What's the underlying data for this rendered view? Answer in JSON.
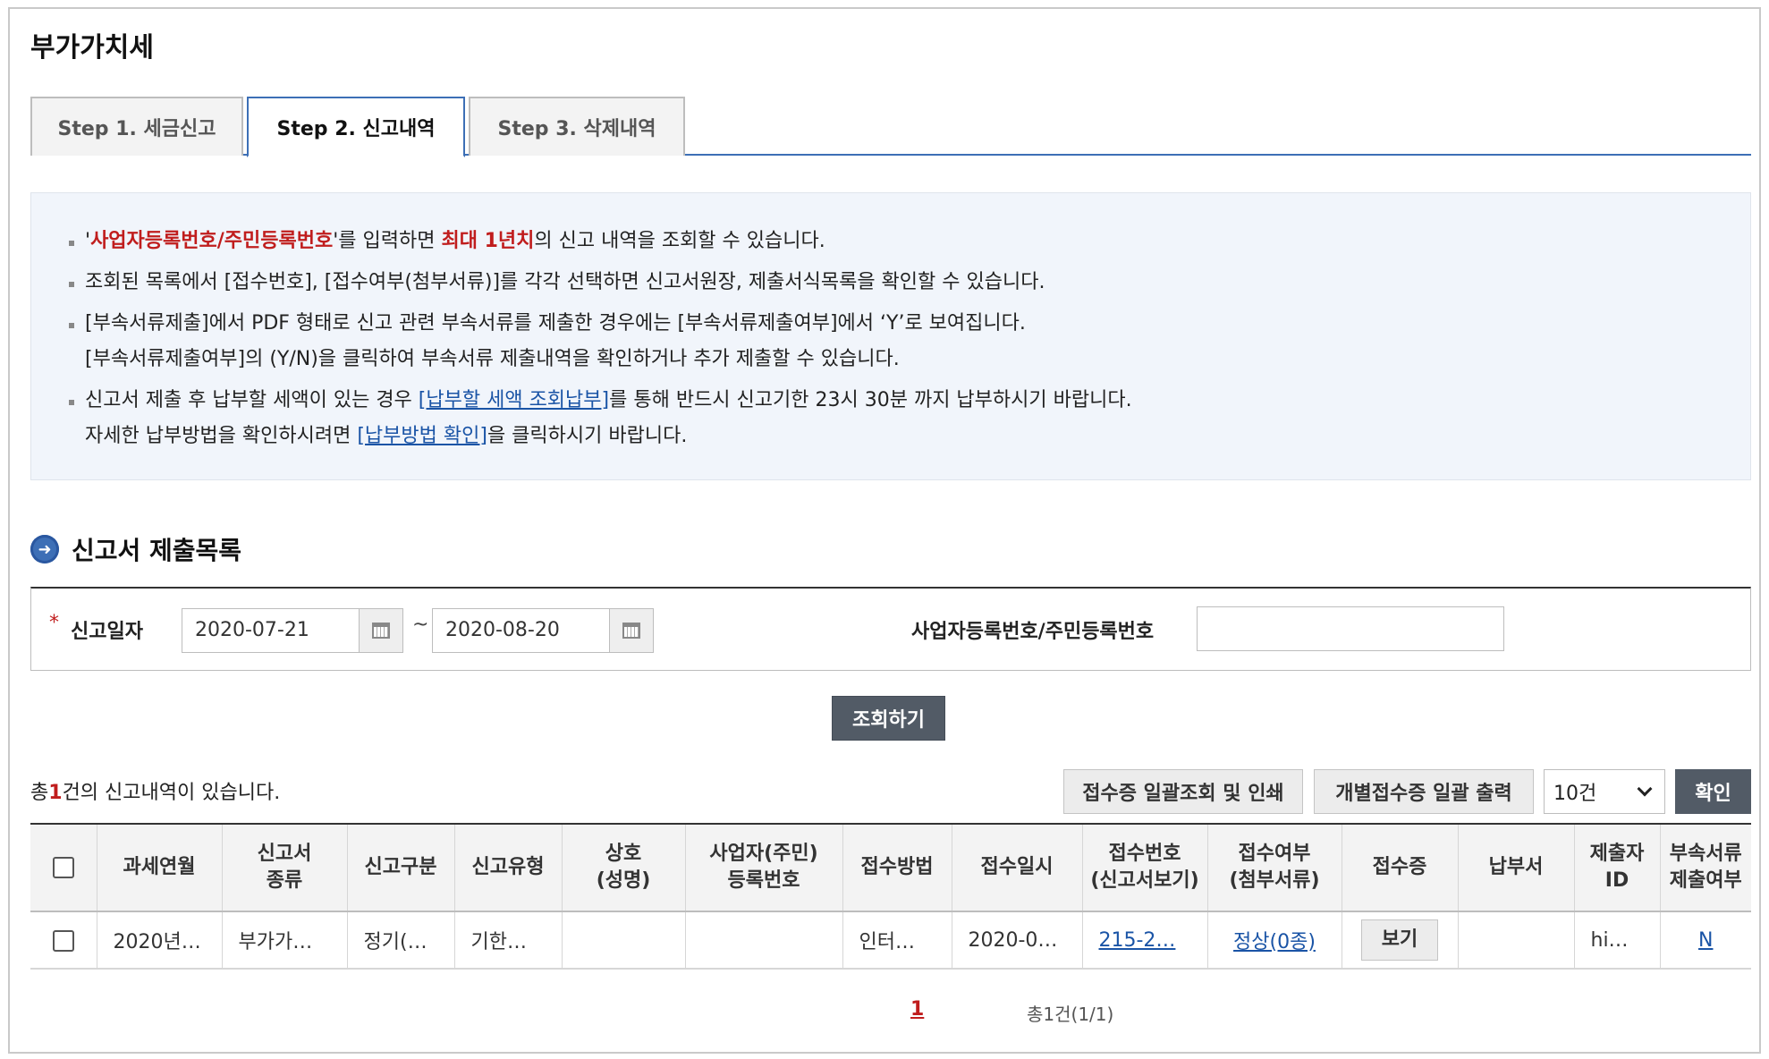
{
  "page_title": "부가가치세",
  "tabs": [
    {
      "label": "Step 1. 세금신고"
    },
    {
      "label": "Step 2. 신고내역"
    },
    {
      "label": "Step 3. 삭제내역"
    }
  ],
  "info": {
    "l1_q1": "'",
    "l1_red1": "사업자등록번호/주민등록번호",
    "l1_t1": "'를 입력하면 ",
    "l1_red2": "최대 1년치",
    "l1_t2": "의 신고 내역을 조회할 수 있습니다.",
    "l2": "조회된 목록에서 [접수번호], [접수여부(첨부서류)]를 각각 선택하면 신고서원장, 제출서식목록을 확인할 수 있습니다.",
    "l3a": "[부속서류제출]에서 PDF 형태로 신고 관련 부속서류를 제출한 경우에는 [부속서류제출여부]에서 ‘Y’로 보여집니다.",
    "l3b": "[부속서류제출여부]의 (Y/N)을 클릭하여 부속서류 제출내역을 확인하거나 추가 제출할 수 있습니다.",
    "l4_t1": "신고서 제출 후 납부할 세액이 있는 경우 ",
    "l4_link": "[납부할 세액 조회납부]",
    "l4_t2": "를 통해 반드시 신고기한 23시 30분 까지 납부하시기 바랍니다.",
    "l5_t1": "자세한 납부방법을 확인하시려면 ",
    "l5_link": "[납부방법 확인]",
    "l5_t2": "을 클릭하시기 바랍니다."
  },
  "section_title": "신고서 제출목록",
  "search": {
    "required_mark": "*",
    "date_label": "신고일자",
    "date_from": "2020-07-21",
    "tilde": "~",
    "date_to": "2020-08-20",
    "biz_label": "사업자등록번호/주민등록번호",
    "biz_value": ""
  },
  "search_button": "조회하기",
  "total": {
    "prefix": "총",
    "count": "1",
    "suffix": "건의 신고내역이 있습니다."
  },
  "actions": {
    "bulk_print": "접수증 일괄조회 및 인쇄",
    "individual_print": "개별접수증 일괄 출력",
    "page_size": "10건",
    "confirm": "확인"
  },
  "table": {
    "headers": [
      {
        "l1": "과세연월",
        "l2": ""
      },
      {
        "l1": "신고서",
        "l2": "종류"
      },
      {
        "l1": "신고구분",
        "l2": ""
      },
      {
        "l1": "신고유형",
        "l2": ""
      },
      {
        "l1": "상호",
        "l2": "(성명)"
      },
      {
        "l1": "사업자(주민)",
        "l2": "등록번호"
      },
      {
        "l1": "접수방법",
        "l2": ""
      },
      {
        "l1": "접수일시",
        "l2": ""
      },
      {
        "l1": "접수번호",
        "l2": "(신고서보기)"
      },
      {
        "l1": "접수여부",
        "l2": "(첨부서류)"
      },
      {
        "l1": "접수증",
        "l2": ""
      },
      {
        "l1": "납부서",
        "l2": ""
      },
      {
        "l1": "제출자",
        "l2": "ID"
      },
      {
        "l1": "부속서류",
        "l2": "제출여부"
      }
    ],
    "row": {
      "period": "2020년…",
      "doc_type": "부가가…",
      "report_class": "정기(…",
      "report_type": "기한…",
      "company": "",
      "reg_no": "",
      "method": "인터…",
      "datetime": "2020-0…",
      "receipt_no": "215-2…",
      "status": "정상(0종)",
      "receipt_btn": "보기",
      "payment": "",
      "submitter": "hi…",
      "attached": "N"
    }
  },
  "pagination": {
    "current": "1",
    "summary": "총1건(1/1)"
  }
}
